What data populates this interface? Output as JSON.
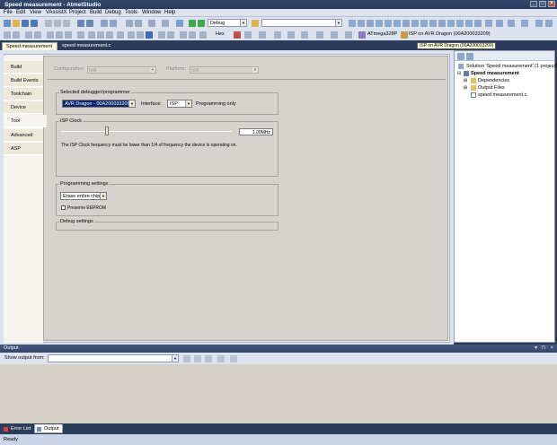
{
  "window": {
    "title": "Speed measurement - AtmelStudio",
    "controls": [
      "_",
      "□",
      "×"
    ]
  },
  "menu": [
    "File",
    "Edit",
    "View",
    "VAssistX",
    "Project",
    "Build",
    "Debug",
    "Tools",
    "Window",
    "Help"
  ],
  "toolbar": {
    "config_combo": "Debug",
    "search_combo": "",
    "hex_label": "Hex",
    "device_label": "ATmega328P",
    "tool_label": "ISP on AVR Dragon (00A200033209)"
  },
  "tabs": {
    "tool_tab": "Speed measurement",
    "close": "×",
    "source_tab": "speed measurement.c",
    "tooltip": "ISP on AVR Dragon (00A200033209)"
  },
  "vtabs": [
    "Build",
    "Build Events",
    "Toolchain",
    "Device",
    "Tool",
    "Advanced",
    "ASP"
  ],
  "config": {
    "configuration_label": "Configuration:",
    "configuration_value": "N/A",
    "platform_label": "Platform:",
    "platform_value": "N/A"
  },
  "debugger": {
    "group": "Selected debugger/programmer",
    "value": "AVR Dragon - 00A200033209",
    "interface_label": "Interface:",
    "interface_value": "ISP",
    "note": "Programming only"
  },
  "isp": {
    "group": "ISP Clock",
    "value": "1.00MHz",
    "slider_fraction": 0.27,
    "note": "The ISP Clock frequency must be lower than 1/4 of frequency the device is operating on."
  },
  "programming": {
    "group": "Programming settings",
    "erase_value": "Erase entire chip",
    "preserve_label": "Preserve EEPROM"
  },
  "debug_settings": {
    "group": "Debug settings"
  },
  "solution": {
    "root": "Solution 'Speed measurement' (1 project)",
    "project": "Speed measurement",
    "items": [
      "Dependencies",
      "Output Files",
      "speed measurement.c"
    ]
  },
  "output": {
    "title": "Output",
    "show_label": "Show output from:",
    "controls": [
      "▾",
      "⊓",
      "×"
    ]
  },
  "bottom_tabs": [
    "Error List",
    "Output"
  ],
  "status": "Ready"
}
